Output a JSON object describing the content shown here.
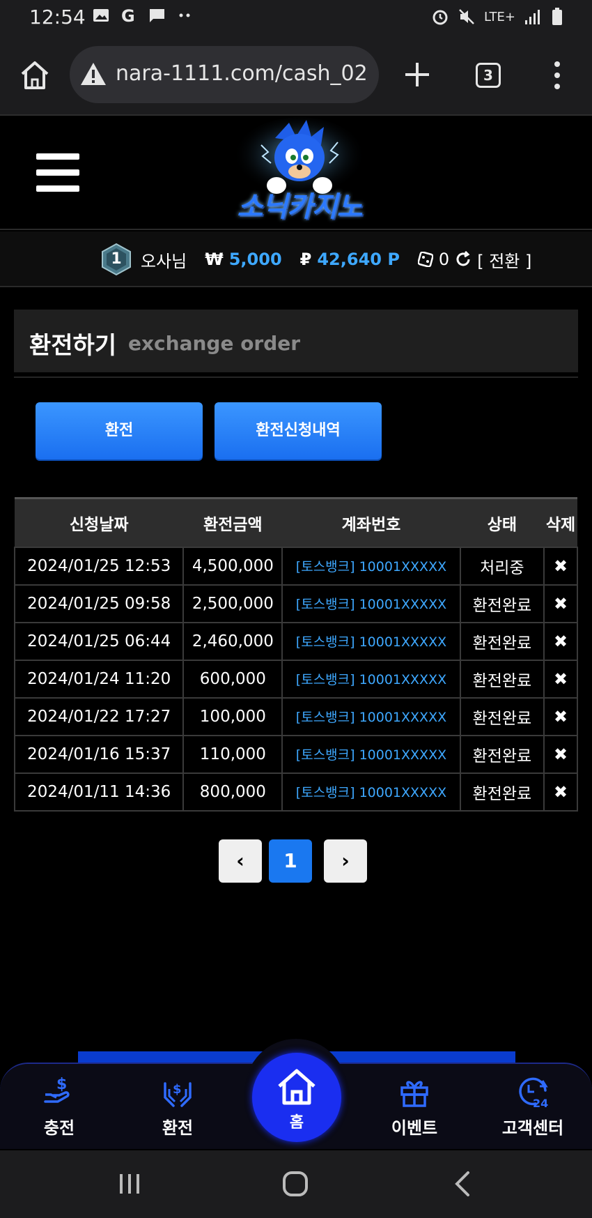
{
  "status_bar": {
    "time": "12:54",
    "network": "LTE+"
  },
  "browser": {
    "url": "nara-1111.com/cash_02",
    "tab_count": "3"
  },
  "site": {
    "logo_text": "소닉카지노"
  },
  "user_bar": {
    "level": "1",
    "username": "오사님",
    "cash_symbol": "₩",
    "cash": "5,000",
    "point_symbol": "₽",
    "points": "42,640 P",
    "chips": "0",
    "convert_label": "[ 전환 ]"
  },
  "page": {
    "title_ko": "환전하기",
    "title_en": "exchange order"
  },
  "actions": {
    "exchange_label": "환전",
    "history_label": "환전신청내역"
  },
  "table": {
    "headers": {
      "date": "신청날짜",
      "amount": "환전금액",
      "account": "계좌번호",
      "status": "상태",
      "delete": "삭제"
    },
    "rows": [
      {
        "date": "2024/01/25 12:53",
        "amount": "4,500,000",
        "account": "[토스뱅크] 10001XXXXX",
        "status": "처리중",
        "delete": "✖"
      },
      {
        "date": "2024/01/25 09:58",
        "amount": "2,500,000",
        "account": "[토스뱅크] 10001XXXXX",
        "status": "환전완료",
        "delete": "✖"
      },
      {
        "date": "2024/01/25 06:44",
        "amount": "2,460,000",
        "account": "[토스뱅크] 10001XXXXX",
        "status": "환전완료",
        "delete": "✖"
      },
      {
        "date": "2024/01/24 11:20",
        "amount": "600,000",
        "account": "[토스뱅크] 10001XXXXX",
        "status": "환전완료",
        "delete": "✖"
      },
      {
        "date": "2024/01/22 17:27",
        "amount": "100,000",
        "account": "[토스뱅크] 10001XXXXX",
        "status": "환전완료",
        "delete": "✖"
      },
      {
        "date": "2024/01/16 15:37",
        "amount": "110,000",
        "account": "[토스뱅크] 10001XXXXX",
        "status": "환전완료",
        "delete": "✖"
      },
      {
        "date": "2024/01/11 14:36",
        "amount": "800,000",
        "account": "[토스뱅크] 10001XXXXX",
        "status": "환전완료",
        "delete": "✖"
      }
    ]
  },
  "pagination": {
    "prev": "‹",
    "current": "1",
    "next": "›"
  },
  "bottom_nav": {
    "charge": "충전",
    "exchange": "환전",
    "home": "홈",
    "event": "이벤트",
    "support": "고객센터"
  },
  "colors": {
    "accent_blue": "#3ea8ff",
    "button_blue": "#1a78f0",
    "nav_blue": "#1a2ef0"
  }
}
